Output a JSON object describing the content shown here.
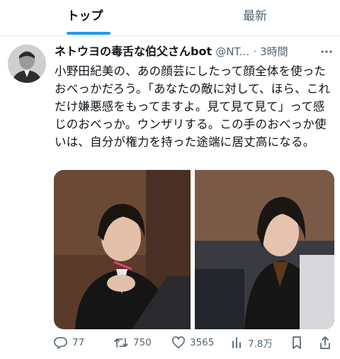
{
  "tabs": {
    "top_label": "トップ",
    "latest_label": "最新"
  },
  "tweet": {
    "display_name": "ネトウヨの毒舌な伯父さんbot",
    "handle": "@NT...",
    "separator": "·",
    "time": "3時間",
    "text": "小野田紀美の、あの顔芸にしたって顔全体を使ったおべっかだろう。「あなたの敵に対して、ほら、これだけ嫌悪感をもってますよ。見て見て見て」って感じのおべっか。ウンザリする。この手のおべっか使いは、自分が権力を持った途端に居丈高になる。"
  },
  "actions": {
    "replies": "77",
    "retweets": "750",
    "likes": "3565",
    "views": "7.8万"
  },
  "colors": {
    "accent": "#1d9bf0",
    "text": "#0f1419",
    "secondary": "#536471"
  },
  "icons": {
    "reply": "reply-icon",
    "retweet": "retweet-icon",
    "like": "heart-icon",
    "views": "bar-chart-icon",
    "bookmark": "bookmark-icon",
    "share": "share-icon",
    "more": "more-icon"
  }
}
